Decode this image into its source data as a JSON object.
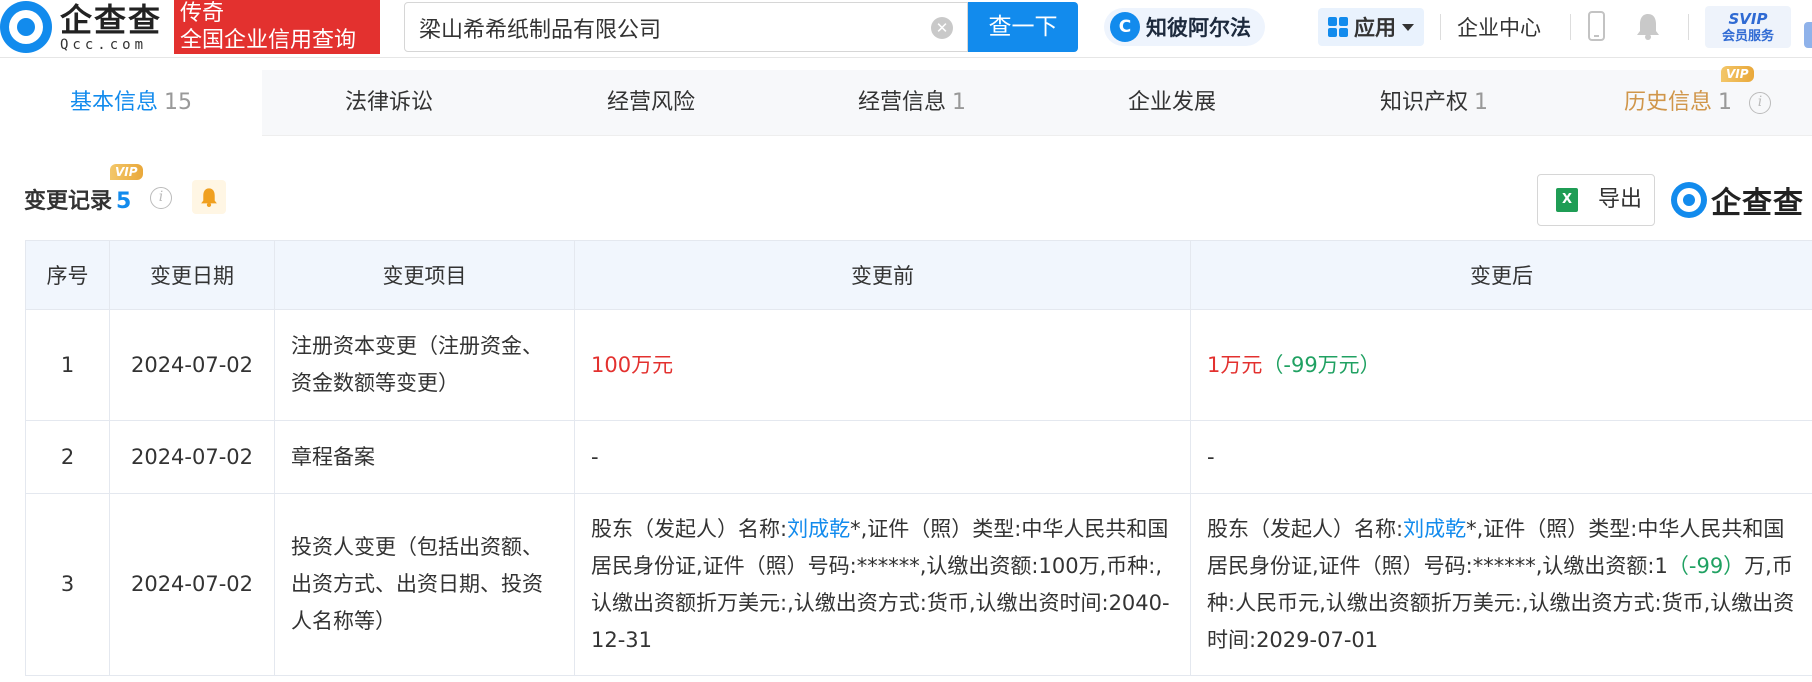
{
  "header": {
    "logo_cn": "企查查",
    "logo_en": "Qcc.com",
    "slogan_line1": "传奇",
    "slogan_line2": "全国企业信用查询",
    "search_value": "梁山希希纸制品有限公司",
    "search_button": "查一下",
    "zhibi_label": "知彼阿尔法",
    "app_label": "应用",
    "enterprise_center": "企业中心",
    "svip_top": "SVIP",
    "svip_bottom": "会员服务"
  },
  "tabs": [
    {
      "label": "基本信息",
      "count": "15"
    },
    {
      "label": "法律诉讼",
      "count": ""
    },
    {
      "label": "经营风险",
      "count": ""
    },
    {
      "label": "经营信息",
      "count": "1"
    },
    {
      "label": "企业发展",
      "count": ""
    },
    {
      "label": "知识产权",
      "count": "1"
    },
    {
      "label": "历史信息",
      "count": "1",
      "badge": "VIP"
    }
  ],
  "section": {
    "title": "变更记录",
    "count": "5",
    "badge": "VIP",
    "export_label": "导出",
    "watermark_logo": "企查查"
  },
  "table": {
    "headers": [
      "序号",
      "变更日期",
      "变更项目",
      "变更前",
      "变更后"
    ],
    "rows": [
      {
        "index": "1",
        "date": "2024-07-02",
        "item": "注册资本变更（注册资金、资金数额等变更）",
        "before": "100万元",
        "after_value": "1万元",
        "after_diff": "（-99万元）"
      },
      {
        "index": "2",
        "date": "2024-07-02",
        "item": "章程备案",
        "before": "-",
        "after": "-"
      },
      {
        "index": "3",
        "date": "2024-07-02",
        "item": "投资人变更（包括出资额、出资方式、出资日期、投资人名称等）",
        "before_prefix": "股东（发起人）名称:",
        "before_name": "刘成乾",
        "before_rest": "*,证件（照）类型:中华人民共和国居民身份证,证件（照）号码:******,认缴出资额:100万,币种:,认缴出资额折万美元:,认缴出资方式:货币,认缴出资时间:2040-12-31",
        "after_prefix": "股东（发起人）名称:",
        "after_name": "刘成乾",
        "after_rest1": "*,证件（照）类型:中华人民共和国居民身份证,证件（照）号码:******,认缴出资额:1",
        "after_diff": "（-99）",
        "after_rest2": "万,币种:人民币元,认缴出资额折万美元:,认缴出资方式:货币,认缴出资时间:2029-07-01"
      }
    ]
  },
  "colors": {
    "brand": "#128bed",
    "decrease_red": "#e3312f",
    "diff_green": "#20a162",
    "history_gold": "#d0964a"
  }
}
